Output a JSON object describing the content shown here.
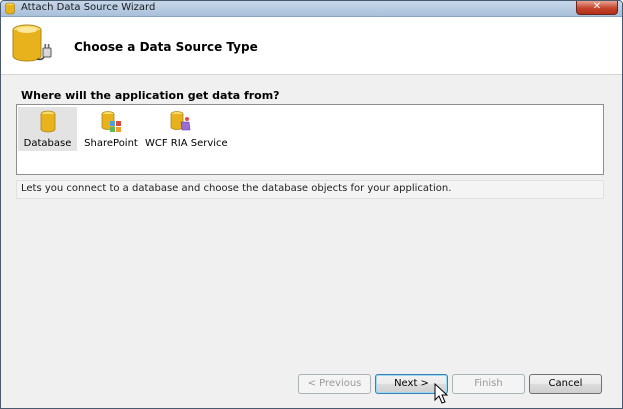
{
  "window": {
    "title": "Attach Data Source Wizard",
    "close_glyph": "✕"
  },
  "header": {
    "title": "Choose a Data Source Type",
    "icon": "database-plug-icon"
  },
  "question": "Where will the application get data from?",
  "source_types": [
    {
      "label": "Database",
      "icon": "database-icon",
      "selected": true
    },
    {
      "label": "SharePoint",
      "icon": "sharepoint-icon",
      "selected": false
    },
    {
      "label": "WCF RIA Service",
      "icon": "wcf-ria-service-icon",
      "selected": false
    }
  ],
  "description": "Lets you connect to a database and choose the database objects for your application.",
  "buttons": {
    "previous": "< Previous",
    "next": "Next >",
    "finish": "Finish",
    "cancel": "Cancel"
  },
  "colors": {
    "db_yellow": "#e8b21c",
    "title_bar": "#b7cce3",
    "selection": "#e3e3e3"
  }
}
